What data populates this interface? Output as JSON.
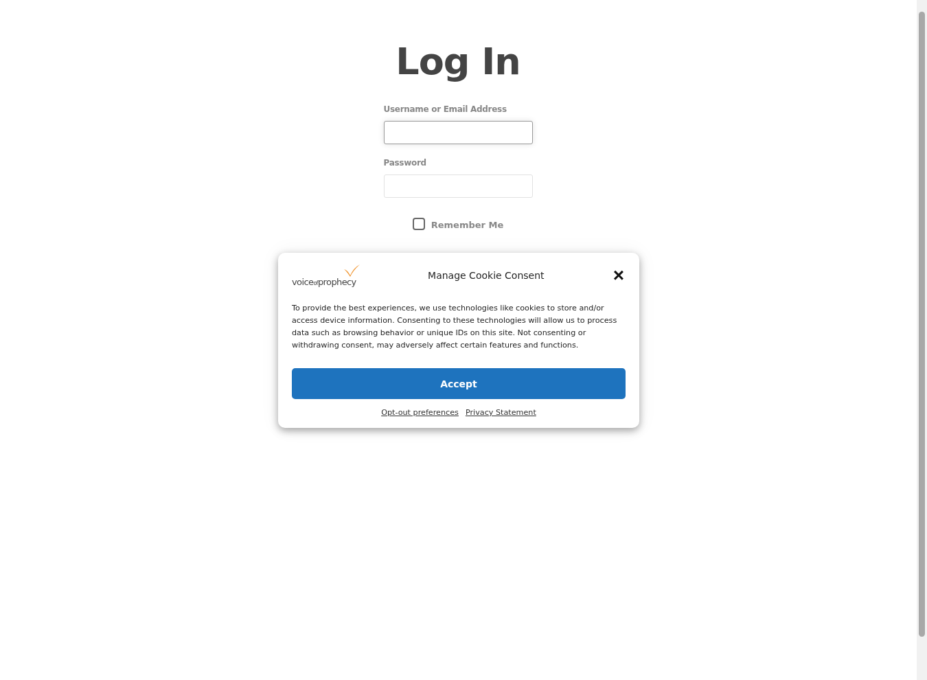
{
  "title": "Log In",
  "fields": [
    {
      "label": "Username or Email Address",
      "focused": true
    },
    {
      "label": "Password",
      "focused": false
    }
  ],
  "remember": {
    "label": "Remember Me",
    "checked": false
  },
  "cookie_dialog": {
    "logo": {
      "word_1": "voice",
      "word_2": "of",
      "word_3": "prophecy"
    },
    "title": "Manage Cookie Consent",
    "close": "×",
    "text": "To provide the best experiences, we use technologies like cookies to store and/or access device information. Consenting to these technologies will allow us to process data such as browsing behavior or unique IDs on this site. Not consenting or withdrawing consent, may adversely affect certain features and functions.",
    "accept": "Accept",
    "links": [
      "Opt-out preferences",
      "Privacy Statement"
    ]
  }
}
